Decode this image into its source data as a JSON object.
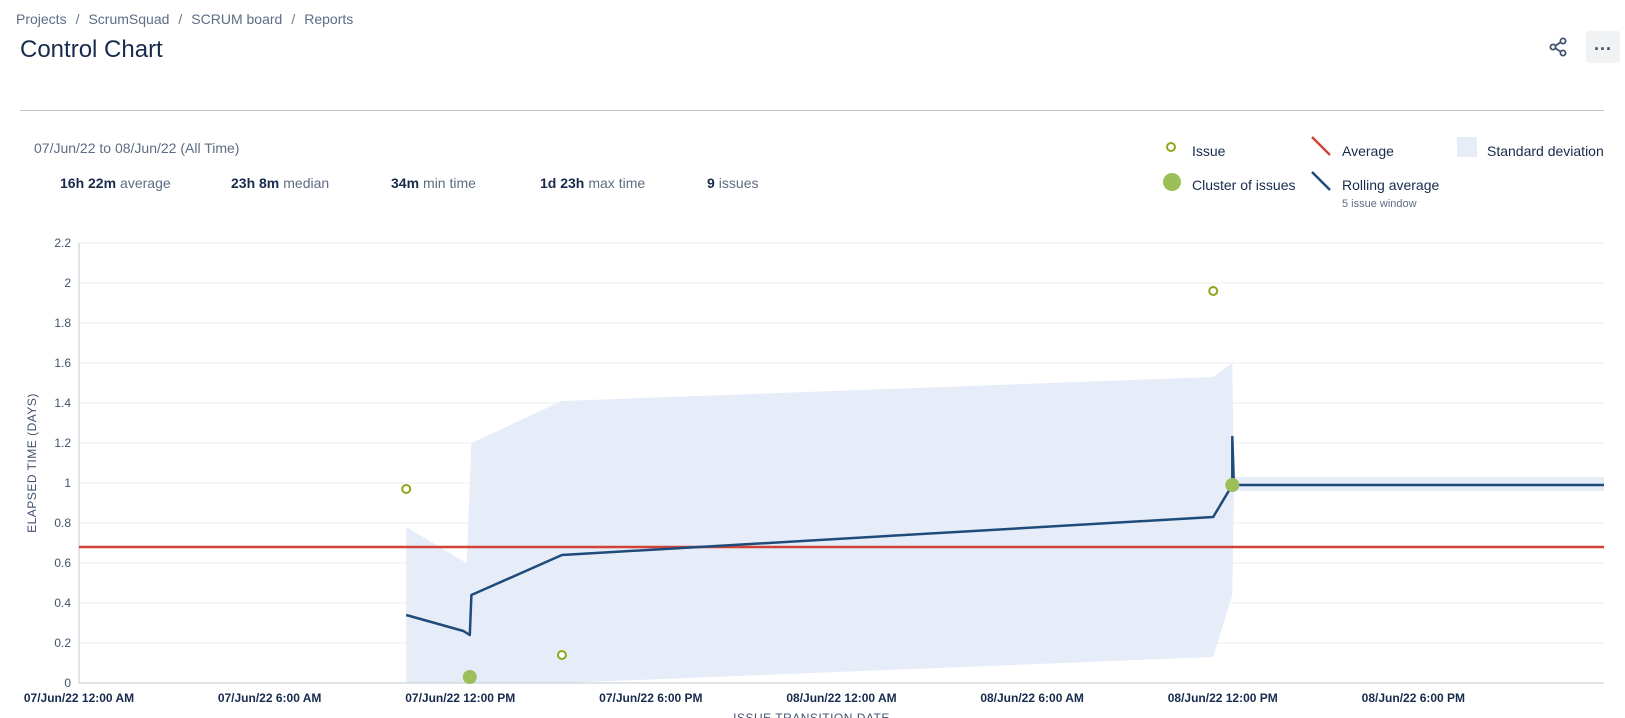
{
  "breadcrumb": {
    "items": [
      "Projects",
      "ScrumSquad",
      "SCRUM board",
      "Reports"
    ],
    "separator": "/"
  },
  "page": {
    "title": "Control Chart"
  },
  "header": {
    "share_icon": "share-icon",
    "more_icon": "more-icon",
    "more_label": "..."
  },
  "summary": {
    "date_range": "07/Jun/22 to 08/Jun/22 (All Time)",
    "stats": [
      {
        "value": "16h 22m",
        "label": "average"
      },
      {
        "value": "23h 8m",
        "label": "median"
      },
      {
        "value": "34m",
        "label": "min time"
      },
      {
        "value": "1d 23h",
        "label": "max time"
      },
      {
        "value": "9",
        "label": "issues"
      }
    ]
  },
  "legend": {
    "issue": "Issue",
    "cluster": "Cluster of issues",
    "average": "Average",
    "rolling": "Rolling average",
    "rolling_sub": "5 issue window",
    "stddev": "Standard deviation"
  },
  "colors": {
    "issue": "#8fa61a",
    "cluster": "#9dbf5a",
    "average": "#d04437",
    "rolling": "#1e4b7a",
    "stddev": "#e6edf8",
    "grid": "#ebecf0"
  },
  "chart_data": {
    "type": "scatter",
    "title": "",
    "xlabel": "ISSUE TRANSITION DATE",
    "ylabel": "ELAPSED TIME (DAYS)",
    "x_domain_hours": [
      0,
      48
    ],
    "x_tick_labels": [
      "07/Jun/22 12:00 AM",
      "07/Jun/22 6:00 AM",
      "07/Jun/22 12:00 PM",
      "07/Jun/22 6:00 PM",
      "08/Jun/22 12:00 AM",
      "08/Jun/22 6:00 AM",
      "08/Jun/22 12:00 PM",
      "08/Jun/22 6:00 PM"
    ],
    "x_ticks_hours": [
      0,
      6,
      12,
      18,
      24,
      30,
      36,
      42
    ],
    "ylim": [
      0,
      2.2
    ],
    "y_ticks": [
      0,
      0.2,
      0.4,
      0.6,
      0.8,
      1,
      1.2,
      1.4,
      1.6,
      1.8,
      2,
      2.2
    ],
    "grid": true,
    "legend_position": "top-right",
    "issues": [
      {
        "hour": 10.3,
        "days": 0.97
      },
      {
        "hour": 15.2,
        "days": 0.14
      },
      {
        "hour": 35.7,
        "days": 1.96
      }
    ],
    "clusters": [
      {
        "hour": 12.3,
        "days": 0.03
      },
      {
        "hour": 36.3,
        "days": 0.99
      }
    ],
    "average": 0.68,
    "rolling_average": [
      {
        "hour": 10.3,
        "days": 0.34
      },
      {
        "hour": 12.1,
        "days": 0.26
      },
      {
        "hour": 12.3,
        "days": 0.24
      },
      {
        "hour": 12.35,
        "days": 0.44
      },
      {
        "hour": 15.2,
        "days": 0.64
      },
      {
        "hour": 35.7,
        "days": 0.83
      },
      {
        "hour": 36.3,
        "days": 0.99
      },
      {
        "hour": 36.3,
        "days": 1.23
      },
      {
        "hour": 36.35,
        "days": 0.99
      },
      {
        "hour": 48,
        "days": 0.99
      }
    ],
    "std_dev_upper": [
      {
        "hour": 10.3,
        "days": 0.78
      },
      {
        "hour": 12.2,
        "days": 0.6
      },
      {
        "hour": 12.35,
        "days": 1.2
      },
      {
        "hour": 15.2,
        "days": 1.41
      },
      {
        "hour": 35.7,
        "days": 1.53
      },
      {
        "hour": 36.3,
        "days": 1.6
      },
      {
        "hour": 36.35,
        "days": 1.03
      },
      {
        "hour": 48,
        "days": 1.03
      }
    ],
    "std_dev_lower": [
      {
        "hour": 48,
        "days": 0.96
      },
      {
        "hour": 36.35,
        "days": 0.96
      },
      {
        "hour": 36.3,
        "days": 0.44
      },
      {
        "hour": 35.7,
        "days": 0.13
      },
      {
        "hour": 15.2,
        "days": 0
      },
      {
        "hour": 10.3,
        "days": 0
      }
    ]
  }
}
